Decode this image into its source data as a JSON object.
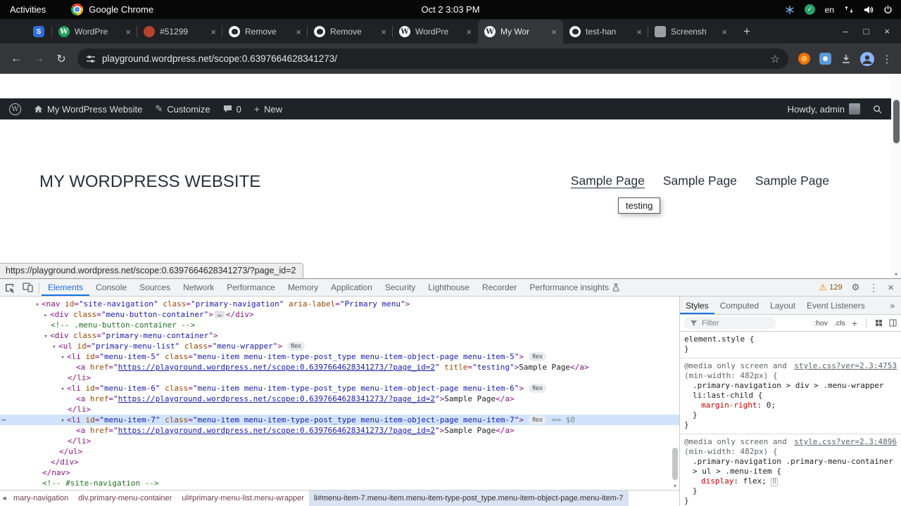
{
  "colors": {
    "accent_blue": "#1a73e8",
    "selection_blue": "#cfe4fc",
    "warning_orange": "#e37400",
    "admin_bar_bg": "#1d2327",
    "syntax_tag": "#881280",
    "syntax_attr": "#994500",
    "syntax_value": "#1a1aa6",
    "syntax_comment": "#236e25",
    "css_property": "#c80000"
  },
  "icons": {
    "check-icon": "✓",
    "back-icon": "←",
    "forward-icon": "→",
    "reload-icon": "↻",
    "star-icon": "☆",
    "kebab-icon": "⋮",
    "plus-icon": "+",
    "pencil-icon": "✎",
    "minimize-icon": "–",
    "maximize-icon": "□",
    "close-icon": "×",
    "gear-icon": "⚙",
    "warning-icon": "⚠",
    "tree-open-icon": "▾",
    "tree-closed-icon": "▸",
    "overflow-dots-icon": "…",
    "row-menu-icon": "⋯",
    "flex-editor-icon": "⠿",
    "more-tabs-icon": "»",
    "crumb-scroll-icon": "◀",
    "scroll-down-icon": "▾",
    "wordpress-logo-icon": "W"
  },
  "system_bar": {
    "activities_label": "Activities",
    "app_name": "Google Chrome",
    "clock": "Oct 2  3:03 PM",
    "language_indicator": "en"
  },
  "browser": {
    "url": "playground.wordpress.net/scope:0.6397664628341273/",
    "favicon_letters": {
      "pinned-site-icon": "S",
      "wordpress-green-icon": "W",
      "wordpress-icon": "W"
    },
    "tabs": [
      {
        "label": "",
        "icon": "pinned-site-icon",
        "pinned": true,
        "active": false
      },
      {
        "label": "WordPre",
        "icon": "wordpress-green-icon",
        "active": false
      },
      {
        "label": "#51299",
        "icon": "trac-ticket-icon",
        "active": false
      },
      {
        "label": "Remove",
        "icon": "github-icon",
        "active": false
      },
      {
        "label": "Remove",
        "icon": "github-icon",
        "active": false
      },
      {
        "label": "WordPre",
        "icon": "wordpress-icon",
        "active": false
      },
      {
        "label": "My Wor",
        "icon": "wordpress-icon",
        "active": true
      },
      {
        "label": "test-han",
        "icon": "github-icon",
        "active": false
      },
      {
        "label": "Screensh",
        "icon": "screenshot-icon",
        "active": false
      }
    ]
  },
  "admin_bar": {
    "site_name": "My WordPress Website",
    "customize_label": "Customize",
    "comment_count": "0",
    "new_label": "New",
    "greeting": "Howdy, admin"
  },
  "page": {
    "site_title": "MY WORDPRESS WEBSITE",
    "nav_items": [
      {
        "label": "Sample Page",
        "hovered": true
      },
      {
        "label": "Sample Page",
        "hovered": false
      },
      {
        "label": "Sample Page",
        "hovered": false
      }
    ],
    "tooltip_text": "testing",
    "link_preview": "https://playground.wordpress.net/scope:0.6397664628341273/?page_id=2"
  },
  "devtools": {
    "warning_count": "129",
    "tabs": [
      {
        "label": "Elements",
        "active": true
      },
      {
        "label": "Console"
      },
      {
        "label": "Sources"
      },
      {
        "label": "Network"
      },
      {
        "label": "Performance"
      },
      {
        "label": "Memory"
      },
      {
        "label": "Application"
      },
      {
        "label": "Security"
      },
      {
        "label": "Lighthouse"
      },
      {
        "label": "Recorder"
      },
      {
        "label": "Performance insights",
        "flask": true
      }
    ],
    "tree": [
      {
        "ind": 1,
        "arrow": "open",
        "src": "<nav id=\"site-navigation\" class=\"primary-navigation\" aria-label=\"Primary menu\">"
      },
      {
        "ind": 2,
        "arrow": "closed",
        "src": "<div class=\"menu-button-container\">",
        "collapsed": true,
        "src_end": "</div>"
      },
      {
        "ind": 2,
        "src": "<!-- .menu-button-container -->"
      },
      {
        "ind": 2,
        "arrow": "open",
        "src": "<div class=\"primary-menu-container\">"
      },
      {
        "ind": 3,
        "arrow": "open",
        "src": "<ul id=\"primary-menu-list\" class=\"menu-wrapper\">",
        "badge": "flex"
      },
      {
        "ind": 4,
        "arrow": "open",
        "src": "<li id=\"menu-item-5\" class=\"menu-item menu-item-type-post_type menu-item-object-page menu-item-5\">",
        "badge": "flex"
      },
      {
        "ind": 5,
        "src": "<a href=\"https://playground.wordpress.net/scope:0.6397664628341273/?page_id=2\" title=\"testing\">Sample Page</a>"
      },
      {
        "ind": 4,
        "src": "</li>"
      },
      {
        "ind": 4,
        "arrow": "open",
        "src": "<li id=\"menu-item-6\" class=\"menu-item menu-item-type-post_type menu-item-object-page menu-item-6\">",
        "badge": "flex"
      },
      {
        "ind": 5,
        "src": "<a href=\"https://playground.wordpress.net/scope:0.6397664628341273/?page_id=2\">Sample Page</a>"
      },
      {
        "ind": 4,
        "src": "</li>"
      },
      {
        "ind": 4,
        "arrow": "open",
        "src": "<li id=\"menu-item-7\" class=\"menu-item menu-item-type-post_type menu-item-object-page menu-item-7\">",
        "badge": "flex",
        "selected": true,
        "annotation": "== $0"
      },
      {
        "ind": 5,
        "src": "<a href=\"https://playground.wordpress.net/scope:0.6397664628341273/?page_id=2\">Sample Page</a>"
      },
      {
        "ind": 4,
        "src": "</li>"
      },
      {
        "ind": 3,
        "src": "</ul>"
      },
      {
        "ind": 2,
        "src": "</div>"
      },
      {
        "ind": 1,
        "src": "</nav>"
      },
      {
        "ind": 1,
        "src": "<!-- #site-navigation -->"
      }
    ],
    "crumbs": [
      {
        "label": "mary-navigation",
        "selected": false
      },
      {
        "label": "div.primary-menu-container",
        "selected": false
      },
      {
        "label": "ul#primary-menu-list.menu-wrapper",
        "selected": false
      },
      {
        "label": "li#menu-item-7.menu-item.menu-item-type-post_type.menu-item-object-page.menu-item-7",
        "selected": true
      }
    ],
    "styles_sidebar": {
      "tabs": [
        {
          "label": "Styles",
          "active": true
        },
        {
          "label": "Computed"
        },
        {
          "label": "Layout"
        },
        {
          "label": "Event Listeners"
        }
      ],
      "filter_placeholder": "Filter",
      "pseudo_toggle": ":hov",
      "class_toggle": ".cls",
      "new_rule": "+",
      "sections": [
        {
          "selector": "element.style",
          "props": []
        },
        {
          "media": "@media only screen and (min-width: 482px) {",
          "source_link": "style.css?ver=2.3:4753",
          "selector": ".primary-navigation > div > .menu-wrapper li:last-child",
          "props": [
            {
              "name": "margin-right",
              "value": "0"
            }
          ]
        },
        {
          "media": "@media only screen and (min-width: 482px) {",
          "source_link": "style.css?ver=2.3:4896",
          "selector": ".primary-navigation .primary-menu-container > ul > .menu-item",
          "props": [
            {
              "name": "display",
              "value": "flex",
              "flex_icon": true
            }
          ]
        }
      ]
    }
  }
}
